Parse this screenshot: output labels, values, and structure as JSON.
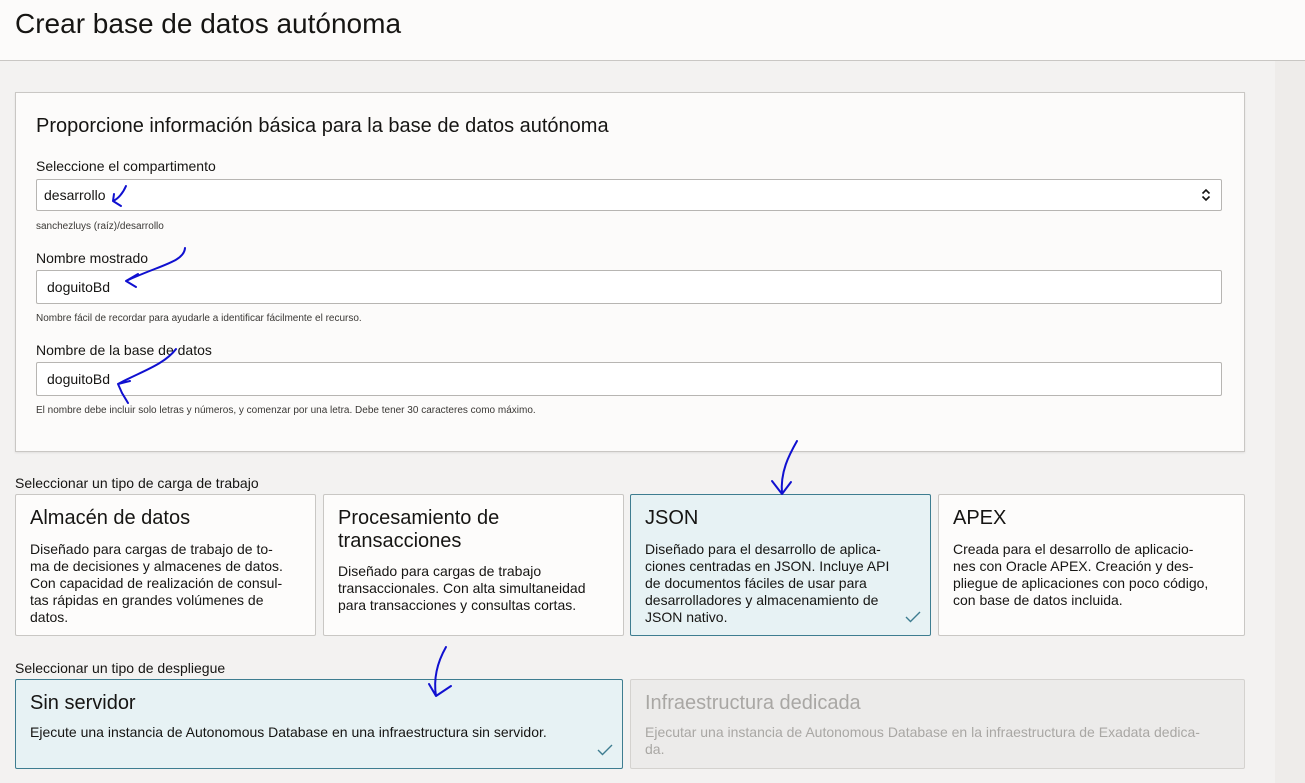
{
  "page": {
    "title": "Crear base de datos autónoma"
  },
  "basic_info": {
    "heading": "Proporcione información básica para la base de datos autónoma",
    "compartment": {
      "label": "Seleccione el compartimento",
      "value": "desarrollo",
      "path_hint": "sanchezluys (raíz)/desarrollo"
    },
    "display_name": {
      "label": "Nombre mostrado",
      "value": "doguitoBd",
      "hint": "Nombre fácil de recordar para ayudarle a identificar fácilmente el recurso."
    },
    "db_name": {
      "label": "Nombre de la base de datos",
      "value": "doguitoBd",
      "hint": "El nombre debe incluir solo letras y números, y comenzar por una letra. Debe tener 30 caracteres como máximo."
    }
  },
  "workload": {
    "section_label": "Seleccionar un tipo de carga de trabajo",
    "selected": "JSON",
    "options": [
      {
        "title": "Almacén de datos",
        "desc_lines": [
          "Diseñado para cargas de trabajo de to-",
          "ma de decisiones y almacenes de datos.",
          "Con capacidad de realización de consul-",
          "tas rápidas en grandes volúmenes de",
          "datos."
        ]
      },
      {
        "title_lines": [
          "Procesamiento de",
          "transacciones"
        ],
        "desc_lines": [
          "Diseñado para cargas de trabajo",
          "transaccionales. Con alta simultaneidad",
          "para transacciones y consultas cortas."
        ]
      },
      {
        "title": "JSON",
        "desc_lines": [
          "Diseñado para el desarrollo de aplica-",
          "ciones centradas en JSON. Incluye API",
          "de documentos fáciles de usar para",
          "desarrolladores y almacenamiento de",
          "JSON nativo."
        ]
      },
      {
        "title": "APEX",
        "desc_lines": [
          "Creada para el desarrollo de aplicacio-",
          "nes con Oracle APEX. Creación y des-",
          "pliegue de aplicaciones con poco código,",
          "con base de datos incluida."
        ]
      }
    ]
  },
  "deployment": {
    "section_label": "Seleccionar un tipo de despliegue",
    "selected": "Sin servidor",
    "options": [
      {
        "title": "Sin servidor",
        "desc_lines": [
          "Ejecute una instancia de Autonomous Database en una infraestructura sin servidor."
        ]
      },
      {
        "title": "Infraestructura dedicada",
        "desc_lines": [
          "Ejecutar una instancia de Autonomous Database en la infraestructura de Exadata dedica-",
          "da."
        ]
      }
    ]
  },
  "colors": {
    "selected_bg": "#e7f2f4",
    "selected_border": "#3e7d90",
    "annotation_ink": "#1010d0"
  },
  "icons": [
    "chevron-up-down-icon",
    "checkmark-icon"
  ]
}
